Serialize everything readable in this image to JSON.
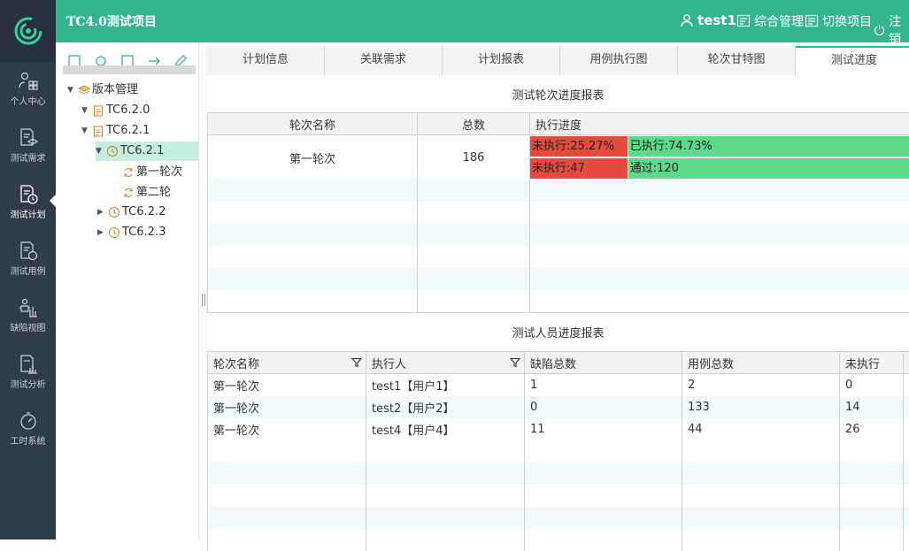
{
  "header": {
    "project_title": "TC4.0测试项目",
    "user": "test1",
    "links": [
      "综合管理",
      "切换项目",
      "注销"
    ]
  },
  "sidebar": {
    "items": [
      {
        "label": "个人中心",
        "icon": "user-grid-icon"
      },
      {
        "label": "测试需求",
        "icon": "doc-layers-icon"
      },
      {
        "label": "测试计划",
        "icon": "doc-clock-icon"
      },
      {
        "label": "测试用例",
        "icon": "doc-timer-icon"
      },
      {
        "label": "缺陷视图",
        "icon": "bug-chart-icon"
      },
      {
        "label": "测试分析",
        "icon": "doc-bars-icon"
      },
      {
        "label": "工时系统",
        "icon": "stopwatch-icon"
      }
    ],
    "active": "测试计划"
  },
  "tree": {
    "root": "版本管理",
    "v620": "TC6.2.0",
    "v621": "TC6.2.1",
    "v6211": "TC6.2.1",
    "round1": "第一轮次",
    "round2": "第二轮",
    "v622": "TC6.2.2",
    "v623": "TC6.2.3"
  },
  "tabs": [
    "计划信息",
    "关联需求",
    "计划报表",
    "用例执行图",
    "轮次甘特图",
    "测试进度"
  ],
  "active_tab": "测试进度",
  "round_report": {
    "title": "测试轮次进度报表",
    "columns": [
      "轮次名称",
      "总数",
      "执行进度"
    ],
    "row": {
      "name": "第一轮次",
      "total": "186",
      "bar1": {
        "left_label": "未执行:25.27%",
        "right_label": "已执行:74.73%",
        "left_fraction": 0.2527
      },
      "bar2": {
        "left_label": "未执行:47",
        "right_label": "通过:120",
        "left_fraction": 0.2527
      }
    }
  },
  "people_report": {
    "title": "测试人员进度报表",
    "columns": [
      "轮次名称",
      "执行人",
      "缺陷总数",
      "用例总数",
      "未执行"
    ],
    "rows": [
      [
        "第一轮次",
        "test1【用户1】",
        "1",
        "2",
        "0"
      ],
      [
        "第一轮次",
        "test2【用户2】",
        "0",
        "133",
        "14"
      ],
      [
        "第一轮次",
        "test4【用户4】",
        "11",
        "44",
        "26"
      ]
    ]
  },
  "colors": {
    "accent": "#35b58f",
    "sidebar": "#2f3d4a",
    "not_executed": "#e64a3c",
    "executed": "#5ed889"
  }
}
